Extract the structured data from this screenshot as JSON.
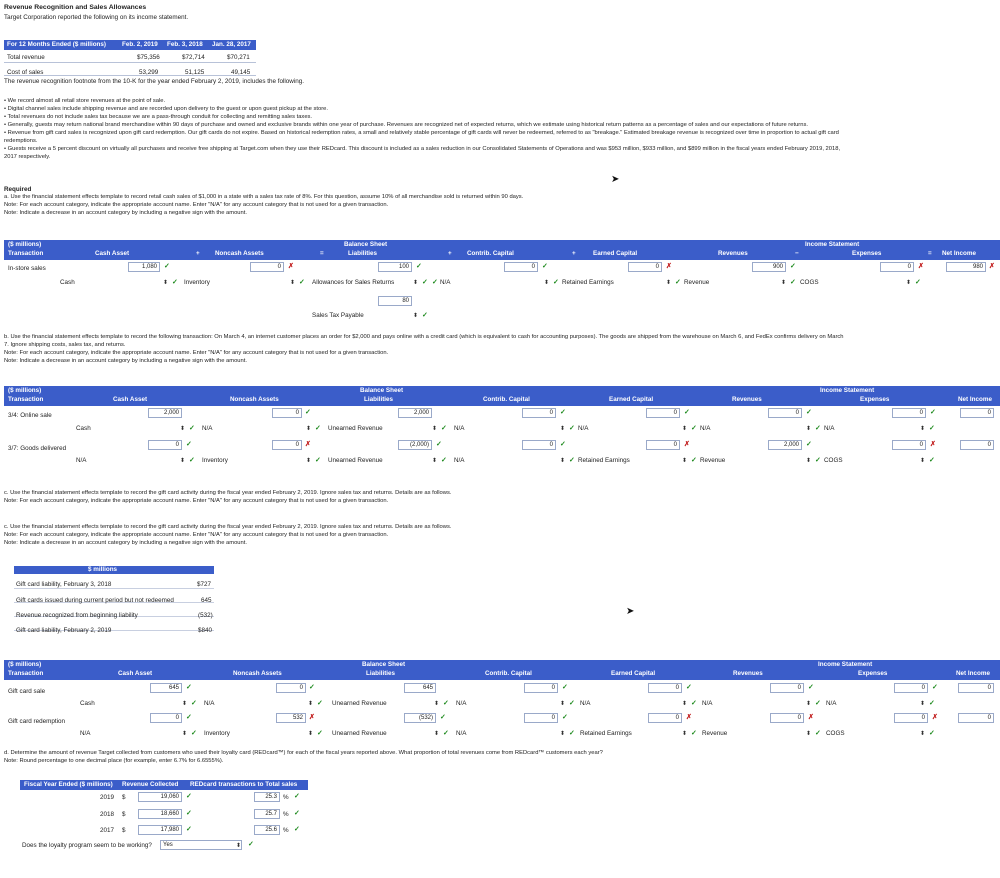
{
  "header": {
    "title": "Revenue Recognition and Sales Allowances",
    "subtitle": "Target Corporation reported the following on its income statement."
  },
  "income_table": {
    "columns": [
      "For 12 Months Ended ($ millions)",
      "Feb. 2, 2019",
      "Feb. 3, 2018",
      "Jan. 28, 2017"
    ],
    "rows": [
      {
        "label": "Total revenue",
        "v1": "$75,356",
        "v2": "$72,714",
        "v3": "$70,271"
      },
      {
        "label": "Cost of sales",
        "v1": "53,299",
        "v2": "51,125",
        "v3": "49,145"
      }
    ]
  },
  "footnote_intro": "The revenue recognition footnote from the 10-K for the year ended February 2, 2019, includes the following.",
  "bullets": [
    "• We record almost all retail store revenues at the point of sale.",
    "• Digital channel sales include shipping revenue and are recorded upon delivery to the guest or upon guest pickup at the store.",
    "• Total revenues do not include sales tax because we are a pass-through conduit for collecting and remitting sales taxes.",
    "• Generally, guests may return national brand merchandise within 90 days of purchase and owned and exclusive brands within one year of purchase. Revenues are recognized net of expected returns, which we estimate using historical return patterns as a percentage of sales and our expectations of future returns.",
    "• Revenue from gift card sales is recognized upon gift card redemption. Our gift cards do not expire. Based on historical redemption rates, a small and relatively stable percentage of gift cards will never be redeemed, referred to as \"breakage.\" Estimated breakage revenue is recognized over time in proportion to actual gift card",
    "redemptions.",
    "• Guests receive a 5 percent discount on virtually all purchases and receive free shipping at Target.com when they use their REDcard. This discount is included as a sales reduction in our Consolidated Statements of Operations and was $953 million, $933 million, and $899 million in the fiscal years ended February 2019, 2018,",
    "2017 respectively."
  ],
  "required": {
    "label": "Required",
    "a_text": "a. Use the financial statement effects template to record retail cash sales of $1,000 in a state with a sales tax rate of 8%. For this question, assume 10% of all merchandise sold is returned within 90 days.",
    "note1": "Note: For each account category, indicate the appropriate account name. Enter \"N/A\" for any account category that is not used for a given transaction.",
    "note2": "Note: Indicate a decrease in an account category by including a negative sign with the amount."
  },
  "template_headers": {
    "units": "($ millions)",
    "transaction": "Transaction",
    "cash_asset": "Cash Asset",
    "noncash_assets": "Noncash Assets",
    "balance_sheet": "Balance Sheet",
    "liabilities": "Liabilities",
    "contrib_capital": "Contrib. Capital",
    "earned_capital": "Earned Capital",
    "revenues": "Revenues",
    "income_statement": "Income Statement",
    "expenses": "Expenses",
    "net_income": "Net Income",
    "plus": "+",
    "minus": "−",
    "eq": "=",
    "millions": "$ millions"
  },
  "section_a": {
    "row_label": "In-store sales",
    "cash_val": "1,080",
    "cash_acct": "Cash",
    "noncash_val": "0",
    "noncash_acct": "Inventory",
    "liab_val1": "100",
    "liab_acct1": "Allowances for Sales Returns",
    "liab_acct1b": "N/A",
    "liab_val2": "80",
    "liab_acct2": "Sales Tax Payable",
    "contrib_val": "0",
    "earned_val": "0",
    "earned_acct": "Retained Earnings",
    "rev_acct": "Revenue",
    "rev_val": "900",
    "exp_val": "0",
    "exp_acct": "COGS",
    "ni_val": "980"
  },
  "section_b": {
    "text": "b. Use the financial statement effects template to record the following transaction: On March 4, an internet customer places an order for $2,000 and pays online with a credit card (which is equivalent to cash for accounting purposes). The goods are shipped from the warehouse on March 6, and FedEx confirms delivery on March",
    "text2": "7. Ignore shipping costs, sales tax, and returns.",
    "note1": "Note: For each account category, indicate the appropriate account name. Enter \"N/A\" for any account category that is not used for a given transaction.",
    "note2": "Note: Indicate a decrease in an account category by including a negative sign with the amount.",
    "rows": [
      {
        "label": "3/4: Online sale",
        "cash": "2,000",
        "cash_acct": "Cash",
        "noncash": "0",
        "noncash_acct": "N/A",
        "liab": "2,000",
        "liab_acct": "Unearned Revenue",
        "liab_acct2": "N/A",
        "contrib": "0",
        "contrib_acct": "N/A",
        "earned": "0",
        "earned_acct": "N/A",
        "rev": "0",
        "rev_acct": "N/A",
        "exp": "0",
        "exp_acct": "N/A",
        "ni": "0"
      },
      {
        "label": "3/7: Goods delivered",
        "cash": "0",
        "cash_acct": "N/A",
        "noncash": "0",
        "noncash_acct": "Inventory",
        "liab": "(2,000)",
        "liab_acct": "Unearned Revenue",
        "liab_acct2": "N/A",
        "contrib": "0",
        "contrib_acct": "Retained Earnings",
        "earned": "0",
        "earned_acct": "Revenue",
        "rev": "2,000",
        "rev_acct": "COGS",
        "exp": "0",
        "exp_acct": "",
        "ni": "0"
      }
    ]
  },
  "section_c": {
    "text": "c. Use the financial statement effects template to record the gift card activity during the fiscal year ended February 2, 2019. Ignore sales tax and returns. Details are as follows.",
    "note1": "Note: For each account category, indicate the appropriate account name. Enter \"N/A\" for any account category that is not used for a given transaction.",
    "text_b": "c. Use the financial statement effects template to record the gift card activity during the fiscal year ended February 2, 2019. Ignore sales tax and returns. Details are as follows.",
    "note1_b": "Note: For each account category, indicate the appropriate account name. Enter \"N/A\" for any account category that is not used for a given transaction.",
    "note2_b": "Note: Indicate a decrease in an account category by including a negative sign with the amount.",
    "gift_rows": [
      {
        "label": "Gift card liability, February 3, 2018",
        "value": "$727"
      },
      {
        "label": "Gift cards issued during current period but not redeemed",
        "value": "645"
      },
      {
        "label": "Revenue recognized from beginning liability",
        "value": "(532)"
      },
      {
        "label": "Gift card liability, February 2, 2019",
        "value": "$840"
      }
    ],
    "rows": [
      {
        "label": "Gift card sale",
        "cash": "645",
        "cash_acct": "Cash",
        "noncash": "0",
        "noncash_acct": "N/A",
        "liab": "645",
        "liab_acct": "Unearned Revenue",
        "liab_acct2": "N/A",
        "contrib": "0",
        "contrib_acct": "N/A",
        "earned": "0",
        "earned_acct": "N/A",
        "rev": "0",
        "rev_acct": "N/A",
        "exp": "0",
        "ni": "0"
      },
      {
        "label": "Gift card redemption",
        "cash": "0",
        "cash_acct": "N/A",
        "noncash": "532",
        "noncash_acct": "Inventory",
        "liab": "(532)",
        "liab_acct": "Unearned Revenue",
        "liab_acct2": "N/A",
        "contrib": "0",
        "contrib_acct": "Retained Earnings",
        "earned": "0",
        "earned_acct": "Revenue",
        "rev": "0",
        "rev_acct": "COGS",
        "exp": "0",
        "ni": "0"
      }
    ]
  },
  "section_d": {
    "text": "d. Determine the amount of revenue Target collected from customers who used their loyalty card (REDcard™) for each of the fiscal years reported above. What proportion of total revenues come from REDcard™ customers each year?",
    "note": "Note: Round percentage to one decimal place (for example, enter 6.7% for 6.6555%).",
    "columns": [
      "Fiscal Year Ended ($ millions)",
      "Revenue Collected",
      "REDcard transactions to Total sales"
    ],
    "rows": [
      {
        "year": "2019",
        "cur": "$",
        "rev": "19,060",
        "pct": "25.3"
      },
      {
        "year": "2018",
        "cur": "$",
        "rev": "18,660",
        "pct": "25.7"
      },
      {
        "year": "2017",
        "cur": "$",
        "rev": "17,980",
        "pct": "25.6"
      }
    ],
    "pct_sign": "%",
    "question": "Does the loyalty program seem to be working?",
    "answer": "Yes"
  }
}
